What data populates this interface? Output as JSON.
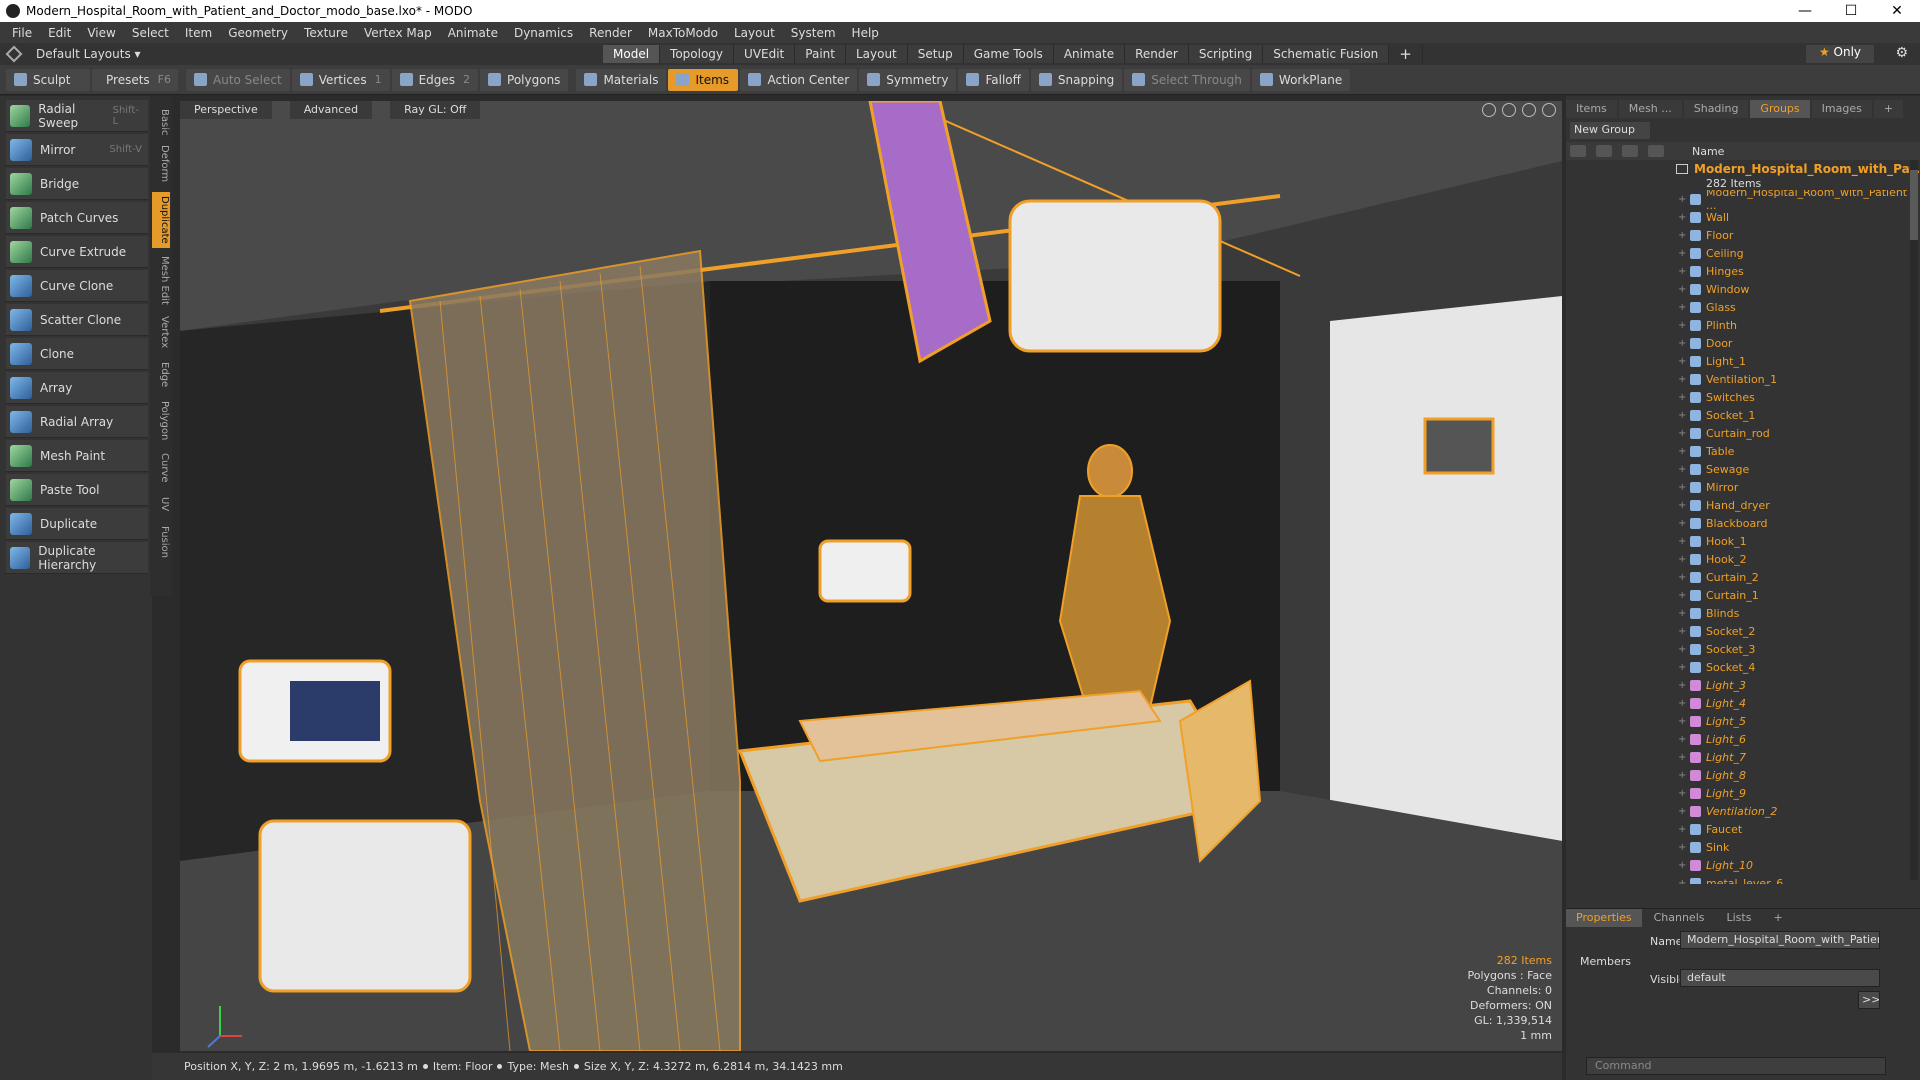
{
  "window": {
    "title": "Modern_Hospital_Room_with_Patient_and_Doctor_modo_base.lxo* - MODO",
    "controls": [
      "—",
      "☐",
      "✕"
    ]
  },
  "menu": [
    "File",
    "Edit",
    "View",
    "Select",
    "Item",
    "Geometry",
    "Texture",
    "Vertex Map",
    "Animate",
    "Dynamics",
    "Render",
    "MaxToModo",
    "Layout",
    "System",
    "Help"
  ],
  "layout": {
    "default_layouts": "Default Layouts ▾",
    "tabs": [
      "Model",
      "Topology",
      "UVEdit",
      "Paint",
      "Layout",
      "Setup",
      "Game Tools",
      "Animate",
      "Render",
      "Scripting",
      "Schematic Fusion"
    ],
    "active_tab": "Model",
    "plus": "+",
    "only": "Only",
    "only_star": "★",
    "gear_icon": "⚙"
  },
  "toolbar": {
    "sculpt": "Sculpt",
    "presets": "Presets",
    "presets_key": "F6",
    "auto_select": "Auto Select",
    "vertices": "Vertices",
    "vertices_count": "1",
    "edges": "Edges",
    "edges_count": "2",
    "polygons": "Polygons",
    "materials": "Materials",
    "items": "Items",
    "action_center": "Action Center",
    "symmetry": "Symmetry",
    "falloff": "Falloff",
    "snapping": "Snapping",
    "select_through": "Select Through",
    "workplane": "WorkPlane"
  },
  "tools": [
    {
      "label": "Radial Sweep",
      "shortcut": "Shift-L"
    },
    {
      "label": "Mirror",
      "shortcut": "Shift-V"
    },
    {
      "label": "Bridge",
      "shortcut": ""
    },
    {
      "label": "Patch Curves",
      "shortcut": ""
    },
    {
      "label": "Curve Extrude",
      "shortcut": ""
    },
    {
      "label": "Curve Clone",
      "shortcut": ""
    },
    {
      "label": "Scatter Clone",
      "shortcut": ""
    },
    {
      "label": "Clone",
      "shortcut": ""
    },
    {
      "label": "Array",
      "shortcut": ""
    },
    {
      "label": "Radial Array",
      "shortcut": ""
    },
    {
      "label": "Mesh Paint",
      "shortcut": ""
    },
    {
      "label": "Paste Tool",
      "shortcut": ""
    },
    {
      "label": "Duplicate",
      "shortcut": ""
    },
    {
      "label": "Duplicate Hierarchy",
      "shortcut": ""
    }
  ],
  "vertical_tabs": [
    "Basic",
    "Deform",
    "Duplicate",
    "Mesh Edit",
    "Vertex",
    "Edge",
    "Polygon",
    "Curve",
    "UV",
    "Fusion"
  ],
  "active_vtab": "Duplicate",
  "viewport": {
    "view": "Perspective",
    "mode": "Advanced",
    "raygl": "Ray GL: Off",
    "info": {
      "items": "282 Items",
      "polygons": "Polygons : Face",
      "channels": "Channels: 0",
      "deformers": "Deformers: ON",
      "gl": "GL: 1,339,514",
      "unit": "1 mm"
    }
  },
  "right_panel": {
    "tabs": [
      "Items",
      "Mesh ...",
      "Shading",
      "Groups",
      "Images"
    ],
    "active_tab": "Groups",
    "plus": "+",
    "new_group": "New Group",
    "name_header": "Name",
    "group_name": "Modern_Hospital_Room_with_Pat...",
    "group_count": "282 Items",
    "items": [
      {
        "label": "Modern_Hospital_Room_with_Patient ...",
        "light": false
      },
      {
        "label": "Wall",
        "light": false
      },
      {
        "label": "Floor",
        "light": false
      },
      {
        "label": "Ceiling",
        "light": false
      },
      {
        "label": "Hinges",
        "light": false
      },
      {
        "label": "Window",
        "light": false
      },
      {
        "label": "Glass",
        "light": false
      },
      {
        "label": "Plinth",
        "light": false
      },
      {
        "label": "Door",
        "light": false
      },
      {
        "label": "Light_1",
        "light": false
      },
      {
        "label": "Ventilation_1",
        "light": false
      },
      {
        "label": "Switches",
        "light": false
      },
      {
        "label": "Socket_1",
        "light": false
      },
      {
        "label": "Curtain_rod",
        "light": false
      },
      {
        "label": "Table",
        "light": false
      },
      {
        "label": "Sewage",
        "light": false
      },
      {
        "label": "Mirror",
        "light": false
      },
      {
        "label": "Hand_dryer",
        "light": false
      },
      {
        "label": "Blackboard",
        "light": false
      },
      {
        "label": "Hook_1",
        "light": false
      },
      {
        "label": "Hook_2",
        "light": false
      },
      {
        "label": "Curtain_2",
        "light": false
      },
      {
        "label": "Curtain_1",
        "light": false
      },
      {
        "label": "Blinds",
        "light": false
      },
      {
        "label": "Socket_2",
        "light": false
      },
      {
        "label": "Socket_3",
        "light": false
      },
      {
        "label": "Socket_4",
        "light": false
      },
      {
        "label": "Light_3",
        "light": true
      },
      {
        "label": "Light_4",
        "light": true
      },
      {
        "label": "Light_5",
        "light": true
      },
      {
        "label": "Light_6",
        "light": true
      },
      {
        "label": "Light_7",
        "light": true
      },
      {
        "label": "Light_8",
        "light": true
      },
      {
        "label": "Light_9",
        "light": true
      },
      {
        "label": "Ventilation_2",
        "light": true
      },
      {
        "label": "Faucet",
        "light": false
      },
      {
        "label": "Sink",
        "light": false
      },
      {
        "label": "Light_10",
        "light": true
      },
      {
        "label": "metal_lever_6",
        "light": false
      }
    ]
  },
  "properties": {
    "tabs": [
      "Properties",
      "Channels",
      "Lists"
    ],
    "active_tab": "Properties",
    "plus": "+",
    "name_label": "Name",
    "name_value": "Modern_Hospital_Room_with_Patient_a",
    "members": "Members",
    "visible_label": "Visible",
    "visible_value": "default",
    "more": ">>",
    "command_placeholder": "Command"
  },
  "status": {
    "position": "Position X, Y, Z:   2 m, 1.9695 m, -1.6213 m",
    "item": "Item:  Floor",
    "type": "Type:  Mesh",
    "size": "Size X, Y, Z:   4.3272 m, 6.2814 m, 34.1423 mm"
  },
  "colors": {
    "accent": "#e59a2a",
    "wire": "#f0a028",
    "panel": "#333333"
  }
}
